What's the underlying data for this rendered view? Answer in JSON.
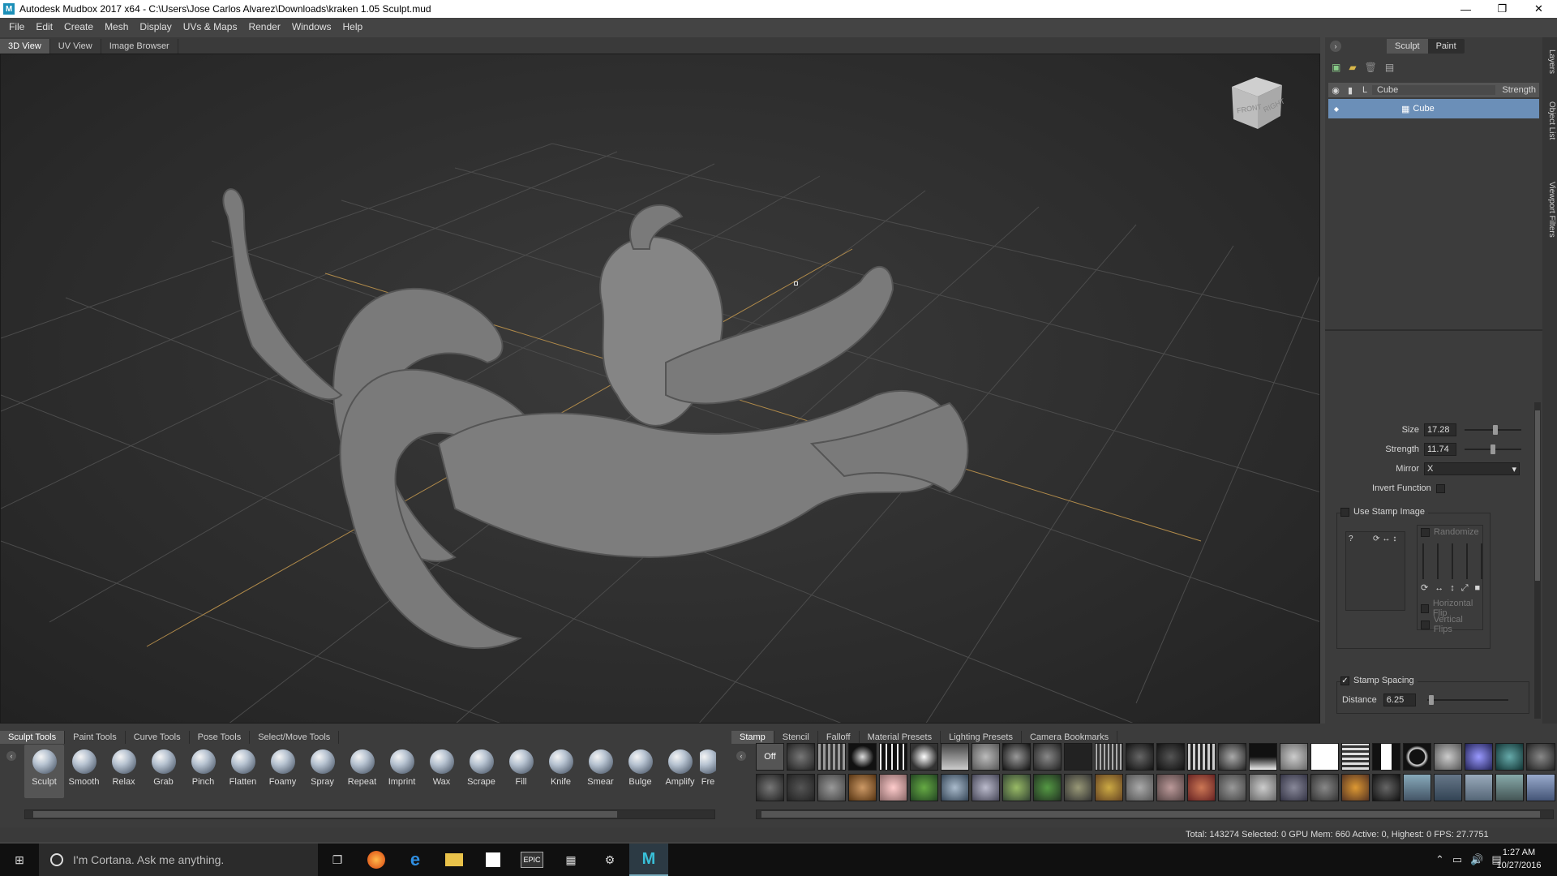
{
  "window": {
    "title": "Autodesk Mudbox 2017 x64 - C:\\Users\\Jose Carlos Alvarez\\Downloads\\kraken 1.05 Sculpt.mud",
    "app_icon": "M"
  },
  "menu": [
    "File",
    "Edit",
    "Create",
    "Mesh",
    "Display",
    "UVs & Maps",
    "Render",
    "Windows",
    "Help"
  ],
  "view_tabs": [
    "3D View",
    "UV View",
    "Image Browser"
  ],
  "viewcube": {
    "front": "FRONT",
    "right": "RIGHT"
  },
  "right_panel": {
    "mode_tabs": [
      "Sculpt",
      "Paint"
    ],
    "active_mode": "Sculpt",
    "layers": {
      "header_name": "Cube",
      "header_strength": "Strength",
      "header_lock": "L",
      "row_name": "Cube"
    },
    "side_tabs": [
      "Layers",
      "Object List",
      "Viewport Filters"
    ],
    "props": {
      "size_label": "Size",
      "size_value": "17.28",
      "size_level": 0.55,
      "strength_label": "Strength",
      "strength_value": "11.74",
      "strength_level": 0.5,
      "mirror_label": "Mirror",
      "mirror_value": "X",
      "invert_label": "Invert Function",
      "use_stamp_label": "Use Stamp Image",
      "randomize_label": "Randomize",
      "horizontal_flip_label": "Horizontal Flip",
      "vertical_flip_label": "Vertical Flips",
      "stamp_spacing_label": "Stamp Spacing",
      "stamp_spacing_check": "✓",
      "distance_label": "Distance",
      "distance_value": "6.25"
    }
  },
  "tool_tabs": [
    "Sculpt Tools",
    "Paint Tools",
    "Curve Tools",
    "Pose Tools",
    "Select/Move Tools"
  ],
  "tools": [
    "Sculpt",
    "Smooth",
    "Relax",
    "Grab",
    "Pinch",
    "Flatten",
    "Foamy",
    "Spray",
    "Repeat",
    "Imprint",
    "Wax",
    "Scrape",
    "Fill",
    "Knife",
    "Smear",
    "Bulge",
    "Amplify",
    "Fre"
  ],
  "stamp_tabs": [
    "Stamp",
    "Stencil",
    "Falloff",
    "Material Presets",
    "Lighting Presets",
    "Camera Bookmarks"
  ],
  "stamp_off_label": "Off",
  "status": "Total: 143274  Selected: 0 GPU Mem: 660  Active: 0, Highest: 0  FPS: 27.7751",
  "taskbar": {
    "cortana": "I'm Cortana. Ask me anything.",
    "time": "1:27 AM",
    "date": "10/27/2016",
    "epic_label": "EPIC"
  }
}
